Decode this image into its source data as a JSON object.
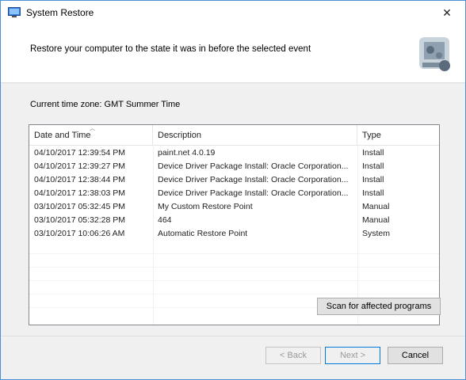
{
  "window": {
    "title": "System Restore",
    "close_glyph": "✕"
  },
  "header": {
    "instruction": "Restore your computer to the state it was in before the selected event"
  },
  "content": {
    "timezone": "Current time zone: GMT Summer Time"
  },
  "list": {
    "columns": [
      "Date and Time",
      "Description",
      "Type"
    ],
    "rows": [
      [
        "04/10/2017 12:39:54 PM",
        "paint.net 4.0.19",
        "Install"
      ],
      [
        "04/10/2017 12:39:27 PM",
        "Device Driver Package Install: Oracle Corporation...",
        "Install"
      ],
      [
        "04/10/2017 12:38:44 PM",
        "Device Driver Package Install: Oracle Corporation...",
        "Install"
      ],
      [
        "04/10/2017 12:38:03 PM",
        "Device Driver Package Install: Oracle Corporation...",
        "Install"
      ],
      [
        "03/10/2017 05:32:45 PM",
        "My Custom Restore Point",
        "Manual"
      ],
      [
        "03/10/2017 05:32:28 PM",
        "464",
        "Manual"
      ],
      [
        "03/10/2017 10:06:26 AM",
        "Automatic Restore Point",
        "System"
      ]
    ]
  },
  "buttons": {
    "scan": "Scan for affected programs",
    "back": "< Back",
    "next": "Next >",
    "cancel": "Cancel"
  },
  "icons": {
    "app": "system-restore-icon",
    "header_art": "restore-graphic-icon"
  }
}
